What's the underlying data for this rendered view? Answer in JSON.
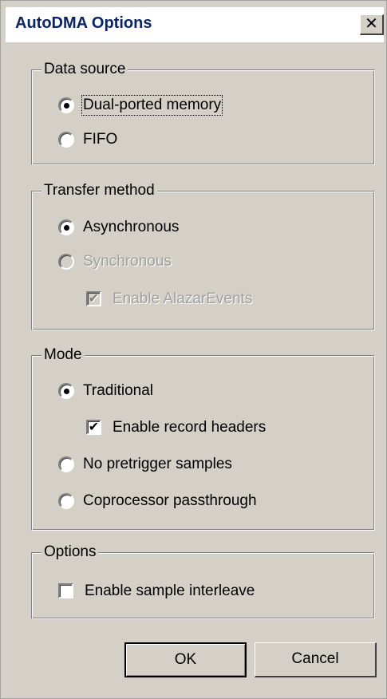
{
  "window": {
    "title": "AutoDMA Options",
    "close_glyph": "✕"
  },
  "data_source": {
    "legend": "Data source",
    "options": [
      {
        "label": "Dual-ported memory",
        "selected": true
      },
      {
        "label": "FIFO",
        "selected": false
      }
    ]
  },
  "transfer_method": {
    "legend": "Transfer method",
    "options": [
      {
        "label": "Asynchronous",
        "selected": true,
        "enabled": true
      },
      {
        "label": "Synchronous",
        "selected": false,
        "enabled": false
      }
    ],
    "enable_events": {
      "label": "Enable AlazarEvents",
      "checked": true,
      "enabled": false
    }
  },
  "mode": {
    "legend": "Mode",
    "options": [
      {
        "label": "Traditional",
        "selected": true
      },
      {
        "label": "No pretrigger samples",
        "selected": false
      },
      {
        "label": "Coprocessor passthrough",
        "selected": false
      }
    ],
    "record_headers": {
      "label": "Enable record headers",
      "checked": true
    }
  },
  "options": {
    "legend": "Options",
    "sample_interleave": {
      "label": "Enable sample interleave",
      "checked": false
    }
  },
  "buttons": {
    "ok": "OK",
    "cancel": "Cancel"
  },
  "glyphs": {
    "check": "✔"
  }
}
